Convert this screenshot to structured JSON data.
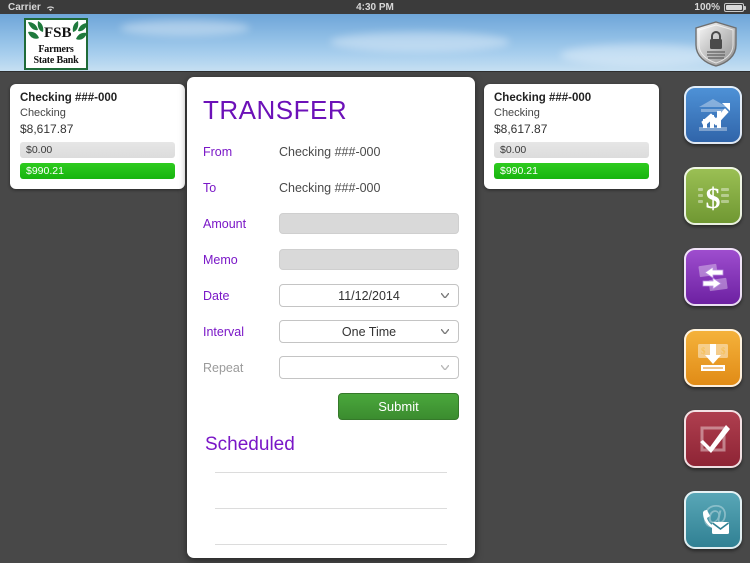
{
  "status_bar": {
    "carrier": "Carrier",
    "wifi_icon": "wifi-icon",
    "time": "4:30 PM",
    "battery_percent": "100%",
    "battery_icon": "battery-icon"
  },
  "header": {
    "logo": {
      "name": "farmers-state-bank-logo",
      "line1": "Farmers",
      "line2": "State Bank"
    },
    "security_icon": "shield-lock-icon"
  },
  "accounts": [
    {
      "title": "Checking ###-000",
      "type": "Checking",
      "balance": "$8,617.87",
      "pending": "$0.00",
      "available": "$990.21"
    },
    {
      "title": "Checking ###-000",
      "type": "Checking",
      "balance": "$8,617.87",
      "pending": "$0.00",
      "available": "$990.21"
    }
  ],
  "modal": {
    "title": "TRANSFER",
    "fields": {
      "from_label": "From",
      "from_value": "Checking ###-000",
      "to_label": "To",
      "to_value": "Checking ###-000",
      "amount_label": "Amount",
      "amount_value": "",
      "memo_label": "Memo",
      "memo_value": "",
      "date_label": "Date",
      "date_value": "11/12/2014",
      "interval_label": "Interval",
      "interval_value": "One Time",
      "repeat_label": "Repeat",
      "repeat_value": ""
    },
    "submit_label": "Submit",
    "scheduled_title": "Scheduled",
    "scheduled_rows": [
      "",
      "",
      ""
    ]
  },
  "rail": {
    "buttons": [
      {
        "name": "accounts-button",
        "icon": "bank-chart-arrow-icon",
        "color": "#2f63a8"
      },
      {
        "name": "payments-button",
        "icon": "dollar-sign-icon",
        "color": "#6e9631"
      },
      {
        "name": "transfers-button",
        "icon": "transfer-arrows-icon",
        "color": "#6b1fa0"
      },
      {
        "name": "deposit-button",
        "icon": "deposit-download-icon",
        "color": "#e08a15"
      },
      {
        "name": "checks-button",
        "icon": "checkmark-box-icon",
        "color": "#8d2334"
      },
      {
        "name": "contact-button",
        "icon": "phone-envelope-at-icon",
        "color": "#2f7f92"
      }
    ]
  }
}
